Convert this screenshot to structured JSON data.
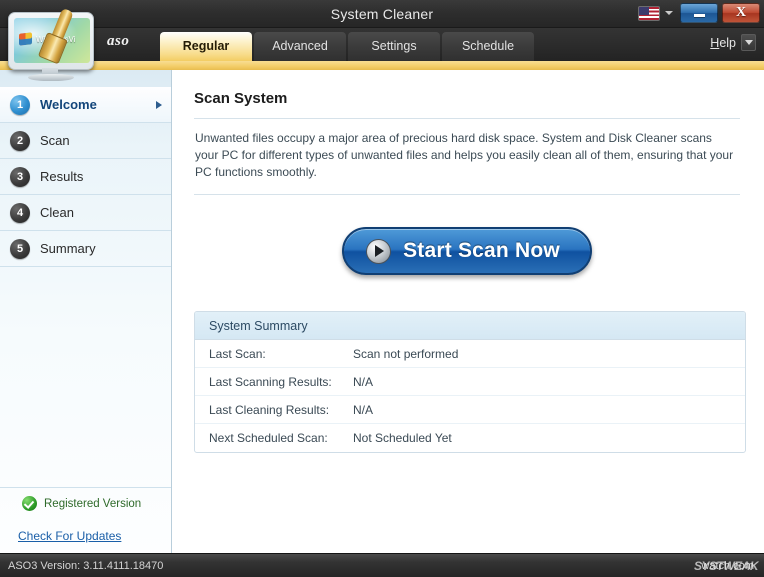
{
  "window": {
    "title": "System Cleaner",
    "controls": {
      "language_flag": "us-flag-icon",
      "language_caret": "chevron-down-icon",
      "minimize_label": "–",
      "close_label": "X"
    }
  },
  "branding": {
    "aso": "aso",
    "logo_screen_text": "WindowsVi"
  },
  "tabs": [
    {
      "label": "Regular",
      "active": true
    },
    {
      "label": "Advanced",
      "active": false
    },
    {
      "label": "Settings",
      "active": false
    },
    {
      "label": "Schedule",
      "active": false
    }
  ],
  "help": {
    "accel": "H",
    "rest": "elp",
    "caret": "chevron-down-icon"
  },
  "sidebar": {
    "items": [
      {
        "num": "1",
        "label": "Welcome",
        "active": true
      },
      {
        "num": "2",
        "label": "Scan",
        "active": false
      },
      {
        "num": "3",
        "label": "Results",
        "active": false
      },
      {
        "num": "4",
        "label": "Clean",
        "active": false
      },
      {
        "num": "5",
        "label": "Summary",
        "active": false
      }
    ],
    "registered_label": "Registered Version",
    "updates_link": "Check For Updates"
  },
  "main": {
    "title": "Scan System",
    "intro": "Unwanted files occupy a major area of precious hard disk space. System and Disk Cleaner scans your PC for different types of unwanted files and helps you easily clean all of them, ensuring that your PC functions smoothly.",
    "scan_button": "Start Scan Now",
    "summary": {
      "header": "System Summary",
      "rows": [
        {
          "key": "Last Scan:",
          "value": "Scan not performed"
        },
        {
          "key": "Last Scanning Results:",
          "value": "N/A"
        },
        {
          "key": "Last Cleaning Results:",
          "value": "N/A"
        },
        {
          "key": "Next Scheduled Scan:",
          "value": "Not Scheduled Yet"
        }
      ]
    }
  },
  "statusbar": {
    "version": "ASO3 Version: 3.11.4111.18470",
    "watermark": "SYSTWEAK",
    "watermark_overlay": "watch.com"
  },
  "colors": {
    "accent_gold": "#f3cd63",
    "accent_blue": "#2a74c0",
    "sidebar_active_blue": "#12457a",
    "link_blue": "#1a5fa8",
    "registered_green": "#2f6a2a",
    "titlebar_dark": "#2e2e2e"
  }
}
